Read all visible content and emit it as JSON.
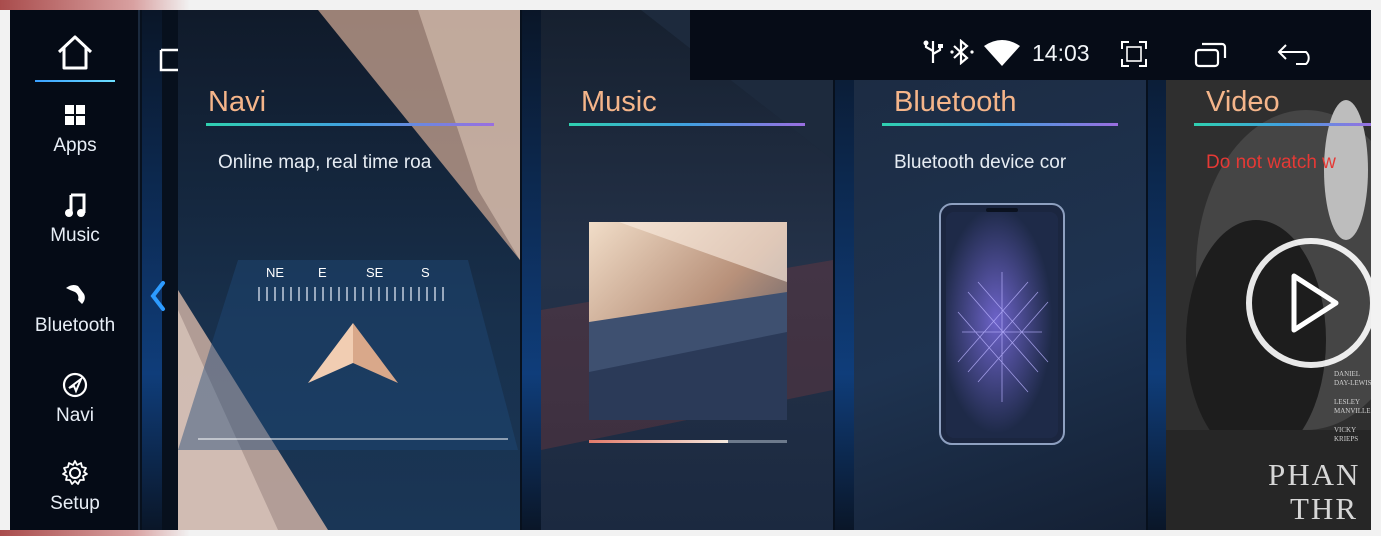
{
  "sidebar": {
    "items": [
      {
        "label": "Apps",
        "icon": "apps-grid-icon"
      },
      {
        "label": "Music",
        "icon": "music-note-icon"
      },
      {
        "label": "Bluetooth",
        "icon": "phone-icon"
      },
      {
        "label": "Navi",
        "icon": "navigation-icon"
      },
      {
        "label": "Setup",
        "icon": "gear-icon"
      }
    ]
  },
  "status": {
    "time": "14:03"
  },
  "cards": {
    "navi": {
      "title": "Navi",
      "desc": "Online map, real time roa"
    },
    "music": {
      "title": "Music"
    },
    "bluetooth": {
      "title": "Bluetooth",
      "desc": "Bluetooth device cor"
    },
    "video": {
      "title": "Video",
      "warning": "Do not watch w"
    }
  },
  "compass": {
    "labels": [
      "NE",
      "E",
      "SE",
      "S"
    ]
  },
  "poster": {
    "credits": [
      "DANIEL DAY-LEWIS",
      "LESLEY MANVILLE",
      "VICKY KRIEPS"
    ],
    "title_1": "PHAN",
    "title_2": "THR"
  },
  "colors": {
    "accent": "#2d9bff",
    "title": "#f5b58a",
    "warning": "#e53935"
  }
}
